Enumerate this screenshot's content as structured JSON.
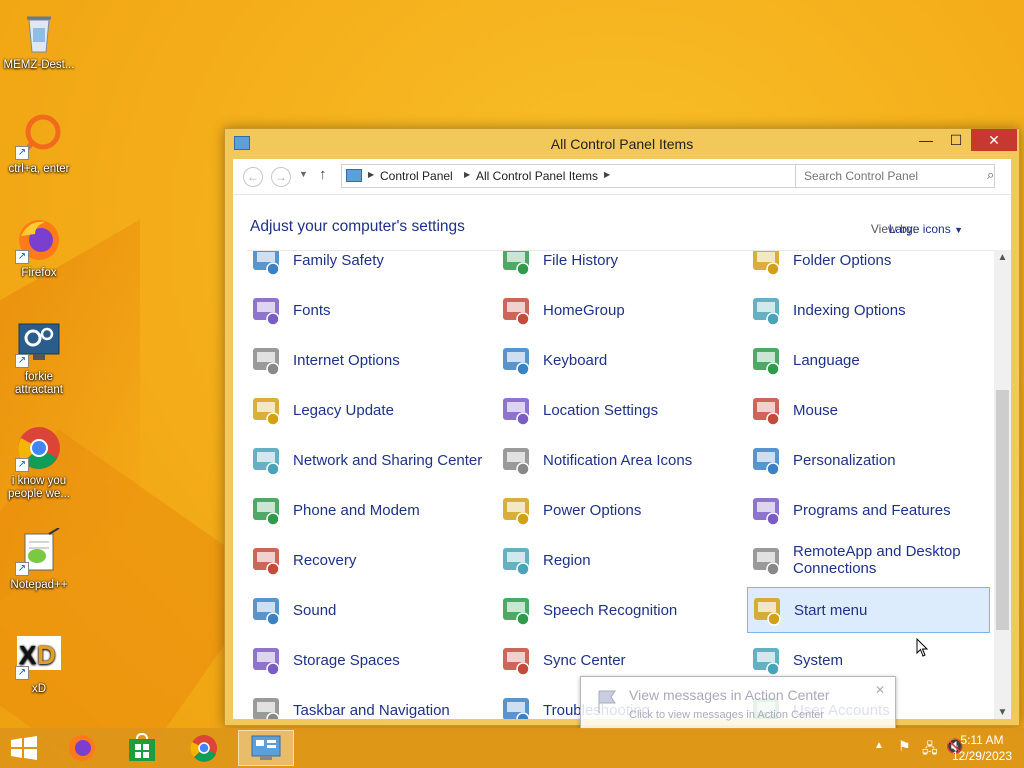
{
  "desktop": {
    "icons": [
      {
        "label": "MEMZ-Dest..."
      },
      {
        "label": "ctrl+a, enter"
      },
      {
        "label": "Firefox"
      },
      {
        "label": "forkie attractant"
      },
      {
        "label": "i know you people we..."
      },
      {
        "label": "Notepad++"
      },
      {
        "label": "xD"
      }
    ]
  },
  "window": {
    "title": "All Control Panel Items",
    "minimize": "—",
    "maximize": "☐",
    "close": "✕",
    "breadcrumb": [
      "Control Panel",
      "All Control Panel Items"
    ],
    "search_placeholder": "Search Control Panel",
    "heading": "Adjust your computer's settings",
    "view_by_label": "View by:",
    "view_by_value": "Large icons"
  },
  "items": [
    {
      "label": "Family Safety",
      "icon": "family-safety-icon"
    },
    {
      "label": "File History",
      "icon": "file-history-icon"
    },
    {
      "label": "Folder Options",
      "icon": "folder-options-icon"
    },
    {
      "label": "Fonts",
      "icon": "fonts-icon"
    },
    {
      "label": "HomeGroup",
      "icon": "homegroup-icon"
    },
    {
      "label": "Indexing Options",
      "icon": "indexing-options-icon"
    },
    {
      "label": "Internet Options",
      "icon": "internet-options-icon"
    },
    {
      "label": "Keyboard",
      "icon": "keyboard-icon"
    },
    {
      "label": "Language",
      "icon": "language-icon"
    },
    {
      "label": "Legacy Update",
      "icon": "legacy-update-icon"
    },
    {
      "label": "Location Settings",
      "icon": "location-settings-icon"
    },
    {
      "label": "Mouse",
      "icon": "mouse-icon"
    },
    {
      "label": "Network and Sharing Center",
      "icon": "network-icon"
    },
    {
      "label": "Notification Area Icons",
      "icon": "notification-area-icon"
    },
    {
      "label": "Personalization",
      "icon": "personalization-icon"
    },
    {
      "label": "Phone and Modem",
      "icon": "phone-modem-icon"
    },
    {
      "label": "Power Options",
      "icon": "power-options-icon"
    },
    {
      "label": "Programs and Features",
      "icon": "programs-features-icon"
    },
    {
      "label": "Recovery",
      "icon": "recovery-icon"
    },
    {
      "label": "Region",
      "icon": "region-icon"
    },
    {
      "label": "RemoteApp and Desktop Connections",
      "icon": "remoteapp-icon"
    },
    {
      "label": "Sound",
      "icon": "sound-icon"
    },
    {
      "label": "Speech Recognition",
      "icon": "speech-recognition-icon"
    },
    {
      "label": "Start menu",
      "icon": "start-menu-icon",
      "selected": true
    },
    {
      "label": "Storage Spaces",
      "icon": "storage-spaces-icon"
    },
    {
      "label": "Sync Center",
      "icon": "sync-center-icon"
    },
    {
      "label": "System",
      "icon": "system-icon"
    },
    {
      "label": "Taskbar and Navigation",
      "icon": "taskbar-navigation-icon"
    },
    {
      "label": "Troubleshooting",
      "icon": "troubleshooting-icon"
    },
    {
      "label": "User Accounts",
      "icon": "user-accounts-icon"
    }
  ],
  "toast": {
    "title": "View messages in Action Center",
    "subtitle": "Click to view messages in Action Center"
  },
  "taskbar": {
    "time": "5:11 AM",
    "date": "12/29/2023"
  },
  "colors": {
    "accent": "#1e3287",
    "close": "#c7392f",
    "desktop": "#f4ac18"
  }
}
